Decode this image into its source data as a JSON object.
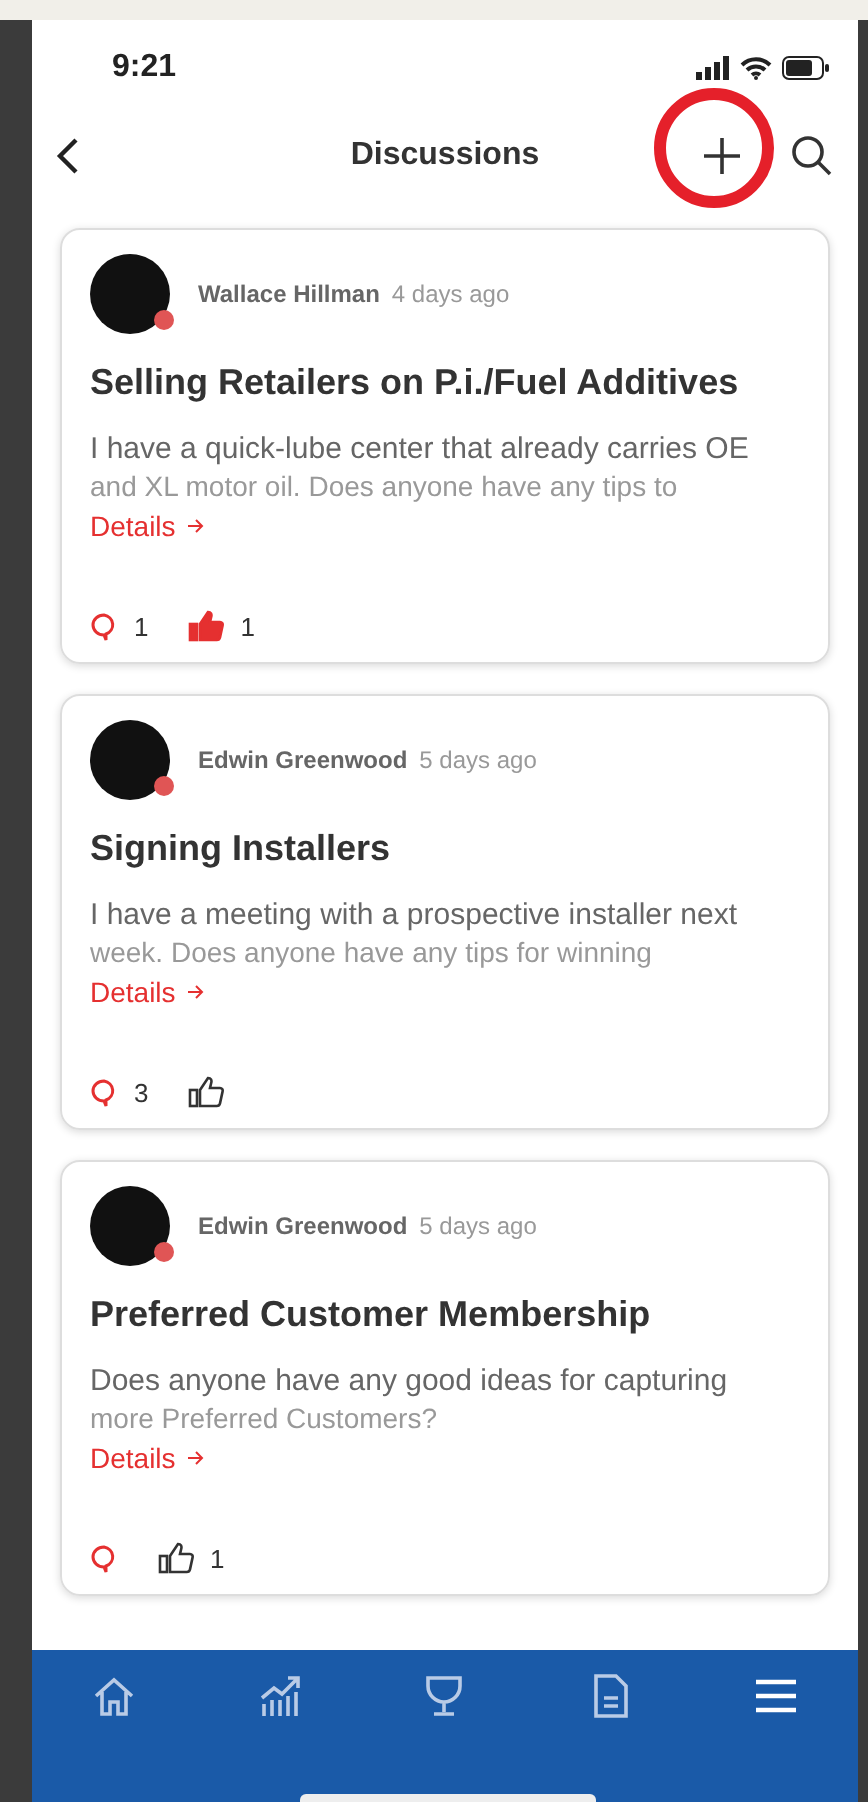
{
  "status_bar": {
    "time": "9:21"
  },
  "header": {
    "title": "Discussions",
    "add_highlighted": true
  },
  "posts": [
    {
      "author": "Wallace Hillman",
      "time": "4 days ago",
      "title": "Selling Retailers on P.i./Fuel Additives",
      "preview": "I have a quick-lube center that already carries OE",
      "preview_faded": "and XL motor oil. Does anyone have any tips to",
      "link": "Details",
      "comments": "1",
      "likes": "1",
      "liked": true
    },
    {
      "author": "Edwin Greenwood",
      "time": "5 days ago",
      "title": "Signing Installers",
      "preview": "I have a meeting with a prospective installer next",
      "preview_faded": "week. Does anyone have any tips for winning",
      "link": "Details",
      "comments": "3",
      "liked": false
    },
    {
      "author": "Edwin Greenwood",
      "time": "5 days ago",
      "title": "Preferred Customer Membership",
      "preview": "Does anyone have any good ideas for capturing",
      "preview_faded": "more Preferred Customers?",
      "link": "Details",
      "likes": "1",
      "liked": false
    }
  ],
  "tab_bar": {
    "tabs": [
      {
        "kind": "home"
      },
      {
        "kind": "chart"
      },
      {
        "kind": "trophy"
      },
      {
        "kind": "document"
      },
      {
        "kind": "menu"
      }
    ]
  }
}
